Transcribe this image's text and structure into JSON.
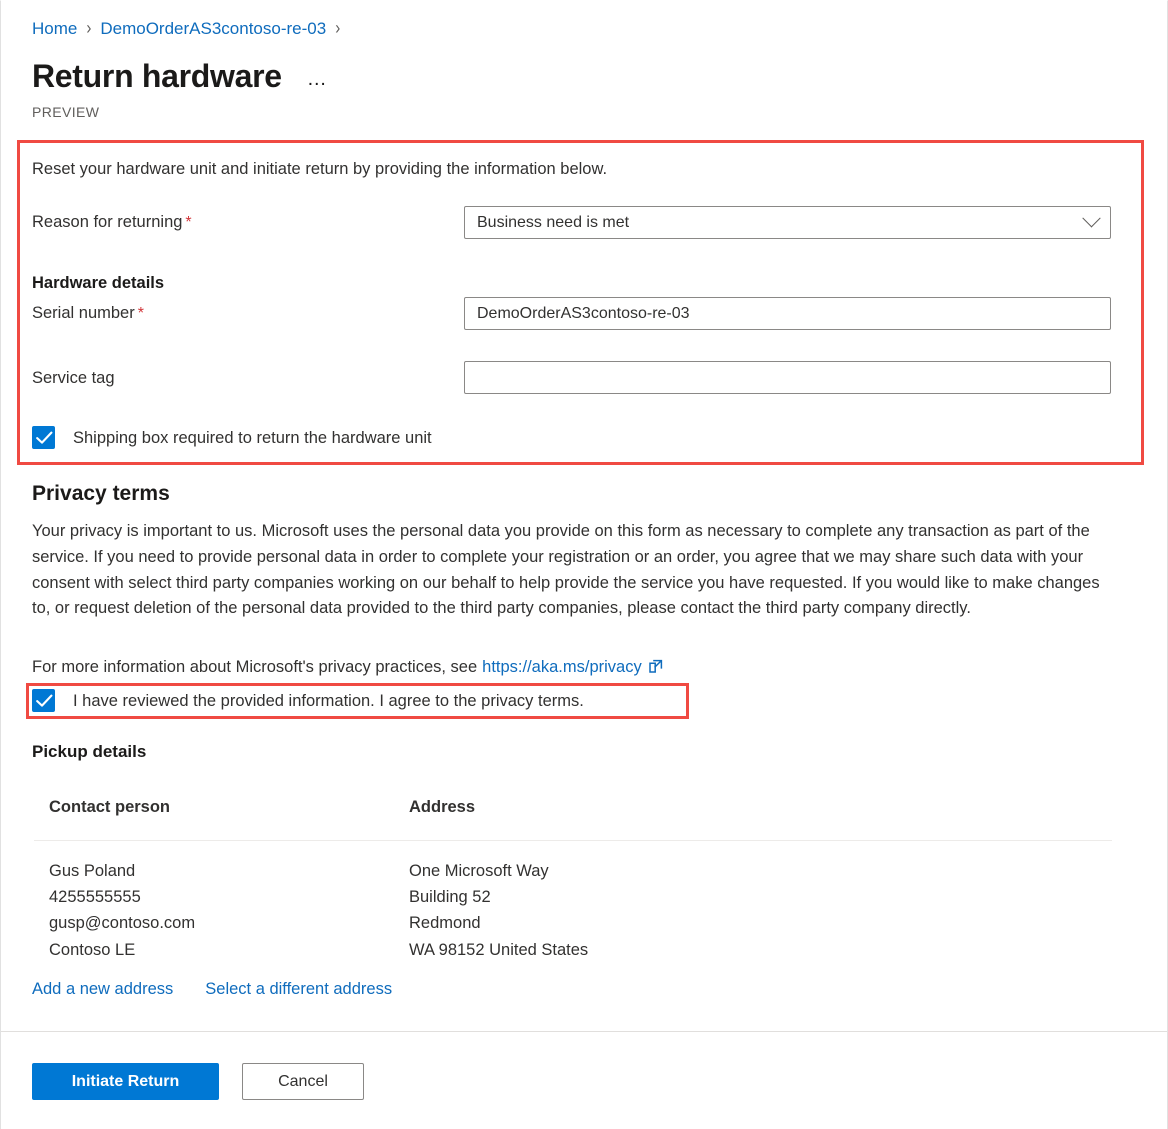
{
  "breadcrumb": {
    "items": [
      {
        "label": "Home"
      },
      {
        "label": "DemoOrderAS3contoso-re-03"
      }
    ],
    "separator": "›"
  },
  "header": {
    "title": "Return hardware",
    "more_menu": "…",
    "preview_tag": "PREVIEW"
  },
  "form": {
    "intro": "Reset your hardware unit and initiate return by providing the information below.",
    "reason": {
      "label": "Reason for returning",
      "required_marker": "*",
      "selected_value": "Business need is met"
    },
    "hardware_details_heading": "Hardware details",
    "serial_number": {
      "label": "Serial number",
      "required_marker": "*",
      "value": "DemoOrderAS3contoso-re-03"
    },
    "service_tag": {
      "label": "Service tag",
      "value": "",
      "placeholder": ""
    },
    "shipping_box_checkbox": {
      "label": "Shipping box required to return the hardware unit",
      "checked": true
    }
  },
  "privacy": {
    "heading": "Privacy terms",
    "body": "Your privacy is important to us. Microsoft uses the personal data you provide on this form as necessary to complete any transaction as part of the service. If you need to provide personal data in order to complete your registration or an order, you agree that we may share such data with your consent with select third party companies working on our behalf to help provide the service you have requested. If you would like to make changes to, or request deletion of the personal data provided to the third party companies, please contact the third party company directly.",
    "more_info_text": "For more information about Microsoft's privacy practices, see",
    "link_text": "https://aka.ms/privacy",
    "agree_checkbox": {
      "label": "I have reviewed the provided information. I agree to the privacy terms.",
      "checked": true
    }
  },
  "pickup": {
    "heading": "Pickup details",
    "columns": [
      "Contact person",
      "Address"
    ],
    "rows": [
      {
        "contact": "Gus Poland\n4255555555\ngusp@contoso.com\nContoso LE",
        "address": "One Microsoft Way\nBuilding 52\nRedmond\nWA 98152 United States"
      }
    ],
    "links": [
      {
        "label": "Add a new address"
      },
      {
        "label": "Select a different address"
      }
    ]
  },
  "footer": {
    "primary_button": "Initiate Return",
    "secondary_button": "Cancel"
  },
  "colors": {
    "accent_blue": "#0078d4",
    "link_blue": "#0f6cbd",
    "annotation_red": "#f04a42",
    "required_red": "#d13438"
  }
}
